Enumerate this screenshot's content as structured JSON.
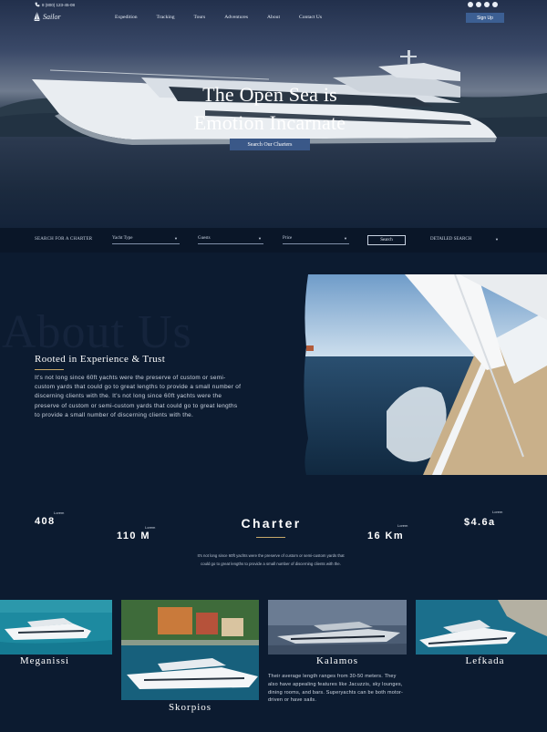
{
  "topbar": {
    "phone": "8 (800) 123-45-08",
    "brand": "Sailor",
    "nav": [
      "Expedition",
      "Tracking",
      "Tours",
      "Adventures",
      "About",
      "Contact Us"
    ],
    "socials": [
      "facebook-icon",
      "instagram-icon",
      "twitter-icon",
      "youtube-icon"
    ],
    "signup_label": "Sign Up"
  },
  "hero": {
    "title_line1": "The Open Sea is",
    "title_line2": "Emotion Incarnate",
    "button_label": "Search Our Charters"
  },
  "search": {
    "label": "SEARCH FOR A CHARTER",
    "yacht_type": "Yacht Type",
    "guests": "Guests",
    "price": "Price",
    "button_label": "Search",
    "detailed_label": "DETAILED SEARCH"
  },
  "about": {
    "watermark": "About Us",
    "heading": "Rooted in Experience & Trust",
    "paragraph": "It's not long since 60ft yachts were the preserve of custom or semi-custom yards that could go to great lengths to provide a small number of discerning clients with the. It's not long since 60ft yachts were the preserve of custom or semi-custom yards that could go to great lengths to provide a small number of discerning clients with the."
  },
  "stats": {
    "items": [
      {
        "label": "Lorem",
        "value": "408"
      },
      {
        "label": "Lorem",
        "value": "110 M"
      },
      {
        "label": "Lorem",
        "value": "16 Km"
      },
      {
        "label": "Lorem",
        "value": "$4.6a"
      }
    ],
    "heading": "Charter",
    "paragraph": "It's not long since 60ft yachts were the preserve of custom or semi-custom yards that could go to great lengths to provide a small number of discerning clients with the."
  },
  "destinations": {
    "items": [
      {
        "name": "Meganissi"
      },
      {
        "name": "Skorpios"
      },
      {
        "name": "Kalamos",
        "description": "Their average length ranges from 30-50 meters. They also have appealing features like Jacuzzis, sky lounges, dining rooms, and bars. Superyachts can be both motor-driven or have sails."
      },
      {
        "name": "Lefkada"
      }
    ]
  },
  "colors": {
    "background": "#0c1b30",
    "accent_button": "#3c5f93",
    "gold_line": "#c8a96a"
  }
}
